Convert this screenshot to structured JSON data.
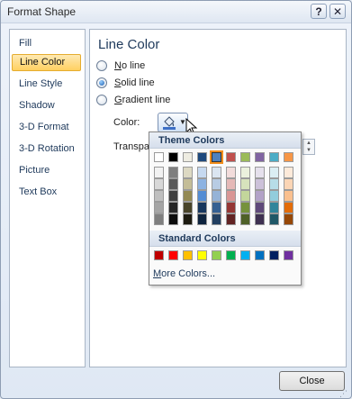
{
  "window": {
    "title": "Format Shape",
    "help": "?",
    "close": "✕"
  },
  "nav": {
    "items": [
      {
        "label": "Fill",
        "selected": false
      },
      {
        "label": "Line Color",
        "selected": true
      },
      {
        "label": "Line Style",
        "selected": false
      },
      {
        "label": "Shadow",
        "selected": false
      },
      {
        "label": "3-D Format",
        "selected": false
      },
      {
        "label": "3-D Rotation",
        "selected": false
      },
      {
        "label": "Picture",
        "selected": false
      },
      {
        "label": "Text Box",
        "selected": false
      }
    ]
  },
  "panel": {
    "title": "Line Color",
    "options": [
      {
        "key": "N",
        "rest": "o line",
        "checked": false
      },
      {
        "key": "S",
        "rest": "olid line",
        "checked": true
      },
      {
        "key": "G",
        "rest": "radient line",
        "checked": false
      }
    ],
    "color_label": "Color:",
    "transparency_label": "Transpa",
    "accent_color": "#3d6fc6"
  },
  "popup": {
    "theme_header": "Theme Colors",
    "standard_header": "Standard Colors",
    "more_colors_key": "M",
    "more_colors_rest": "ore Colors...",
    "theme_colors": [
      [
        "#ffffff",
        "#000000",
        "#eeece1",
        "#1f497d",
        "#4f81bd",
        "#c0504d",
        "#9bbb59",
        "#8064a2",
        "#4bacc6",
        "#f79646"
      ],
      [
        "#f2f2f2",
        "#7f7f7f",
        "#ddd9c3",
        "#c6d9f0",
        "#dbe5f1",
        "#f2dcdb",
        "#ebf1dd",
        "#e5e0ec",
        "#dbeef3",
        "#fdeada"
      ],
      [
        "#d8d8d8",
        "#595959",
        "#c4bd97",
        "#8db3e2",
        "#b8cce4",
        "#e5b9b7",
        "#d7e3bc",
        "#ccc1d9",
        "#b7dde8",
        "#fbd5b5"
      ],
      [
        "#bfbfbf",
        "#3f3f3f",
        "#938953",
        "#548dd4",
        "#95b3d7",
        "#d99694",
        "#c3d69b",
        "#b2a2c7",
        "#92cddc",
        "#fac08f"
      ],
      [
        "#a5a5a5",
        "#262626",
        "#494429",
        "#17365d",
        "#366092",
        "#953734",
        "#76923c",
        "#5f497a",
        "#31859b",
        "#e36c09"
      ],
      [
        "#7f7f7f",
        "#0c0c0c",
        "#1d1b10",
        "#0f243e",
        "#244061",
        "#632423",
        "#4f6128",
        "#3f3151",
        "#205867",
        "#974806"
      ]
    ],
    "selected_swatch": "#4f81bd",
    "standard_colors": [
      "#c00000",
      "#ff0000",
      "#ffc000",
      "#ffff00",
      "#92d050",
      "#00b050",
      "#00b0f0",
      "#0070c0",
      "#002060",
      "#7030a0"
    ]
  },
  "footer": {
    "close_label": "Close"
  }
}
